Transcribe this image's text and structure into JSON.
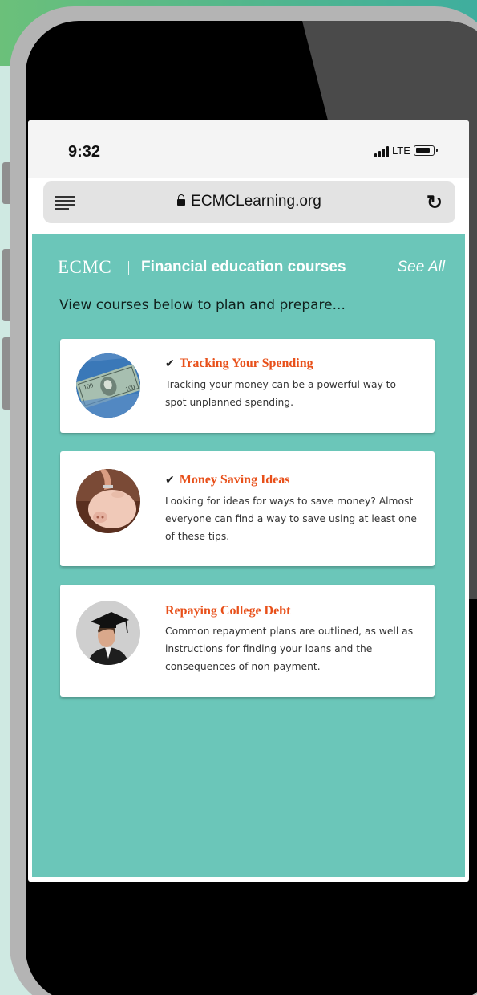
{
  "status": {
    "time": "9:32",
    "network": "LTE"
  },
  "browser": {
    "url": "ECMCLearning.org"
  },
  "brand": {
    "logo": "ECMC",
    "section_title": "Financial education courses",
    "see_all": "See All"
  },
  "subtitle": "View courses below to plan and prepare...",
  "courses": [
    {
      "title": "Tracking Your Spending",
      "completed": true,
      "description": "Tracking your money can be a powerful way to spot unplanned spending.",
      "image": "dollar-bill-image"
    },
    {
      "title": "Money Saving Ideas",
      "completed": true,
      "description": "Looking for ideas for ways to save money? Almost everyone can find a way to save using at least one of these tips.",
      "image": "piggy-bank-image"
    },
    {
      "title": "Repaying College Debt",
      "completed": false,
      "description": "Common repayment plans are outlined, as well as instructions for finding your loans and the consequences of non-payment.",
      "image": "graduate-image"
    }
  ],
  "icons": {
    "check": "✔",
    "reload": "↻"
  },
  "colors": {
    "accent": "#e8501a",
    "panel": "#6bc6b9"
  }
}
